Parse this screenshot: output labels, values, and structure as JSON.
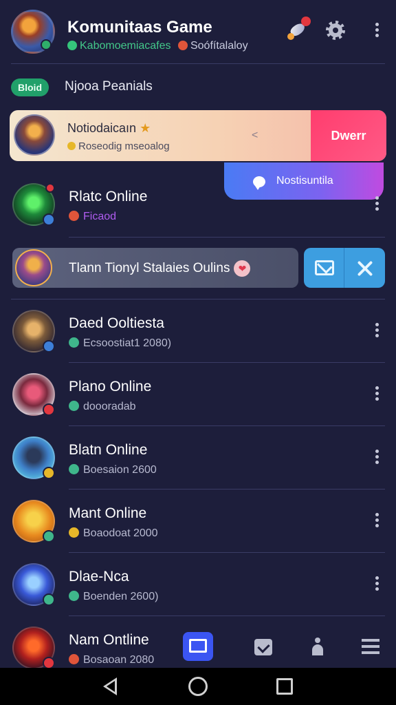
{
  "header": {
    "title": "Komunitaas Game",
    "subtitle_green": "Kabomoemiacafes",
    "subtitle_rest": "Soófítalaloy",
    "icons": [
      "rocket-icon",
      "gear-icon",
      "more-vert-icon"
    ]
  },
  "section": {
    "pill": "Bloid",
    "title": "Njooa Peanials"
  },
  "notification": {
    "title": "Notiodaicaın",
    "star": "★",
    "subtitle": "Roseodiɡ mseoalog",
    "dismiss": "<",
    "action_label": "Dwerr",
    "popup_label": "Nostisuntila"
  },
  "swipe_row": {
    "text": "Tlann Tionyl Stalaies Oulins",
    "heart": "❤"
  },
  "rows": [
    {
      "name": "Rlatc Online",
      "status": "Ficaod",
      "status_color": "#b05cf0"
    },
    {
      "name": "Daed Ooltiesta",
      "status": "Ecsoostiat1 2080)",
      "status_color": "#3fb68b"
    },
    {
      "name": "Plano Online",
      "status": "doooradab",
      "status_color": "#3fb68b"
    },
    {
      "name": "Blatn Online",
      "status": "Boesaion 2600",
      "status_color": "#3fb68b"
    },
    {
      "name": "Mant Online",
      "status": "Boaodoat 2000",
      "status_color": "#e6b729"
    },
    {
      "name": "Dlae-Nca",
      "status": "Boenden 2600)",
      "status_color": "#3fb68b"
    },
    {
      "name": "Nam Ontline",
      "status": "Bosaoan 2080",
      "status_color": "#e0553a"
    }
  ],
  "colors": {
    "background": "#1d1e3b",
    "accent_pink": "#ff3d6e",
    "accent_blue": "#3b55f2",
    "online_green": "#3fb68b"
  }
}
